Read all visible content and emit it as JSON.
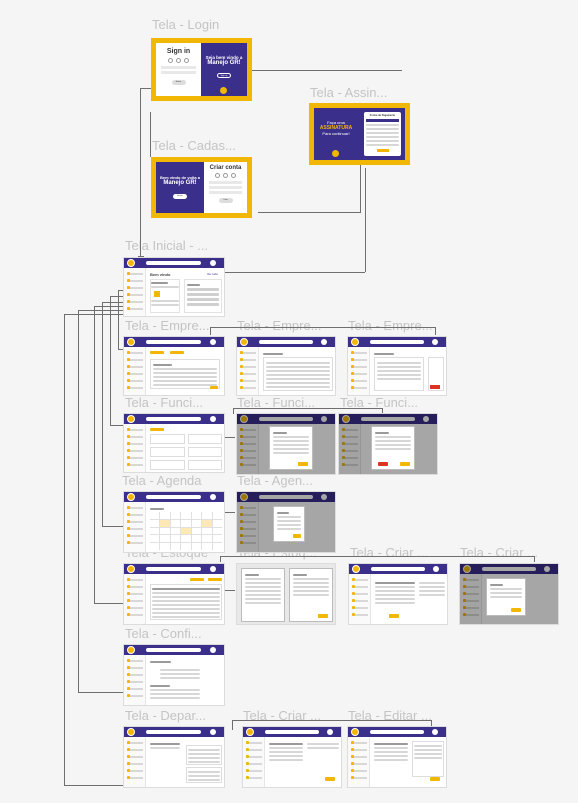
{
  "labels": {
    "login": "Tela - Login",
    "assinatura": "Tela - Assin...",
    "cadastro": "Tela - Cadas...",
    "inicial": "Tela Inicial - ...",
    "empresa1": "Tela - Empre...",
    "empresa2": "Tela - Empre...",
    "empresa3": "Tela - Empre...",
    "func1": "Tela - Funci...",
    "func2": "Tela - Funci...",
    "func3": "Tela - Funci...",
    "agenda1": "Tela - Agenda",
    "agenda2": "Tela - Agen...",
    "estoque1": "Tela - Estoque",
    "estoque2": "Tela - Estoq...",
    "criar1": "Tela - Criar ...",
    "criar2": "Tela - Criar ...",
    "config": "Tela - Confi...",
    "depar": "Tela - Depar...",
    "criar3": "Tela - Criar ...",
    "editar": "Tela - Editar ..."
  },
  "login": {
    "title": "Sign in",
    "welcome": "Seja bem vindo a",
    "brand": "Manejo GR!",
    "btn": "Entrar",
    "cta": "Sign up"
  },
  "cadastro": {
    "title": "Criar conta",
    "welcome": "Bem vindo de volta a",
    "brand": "Manejo GR!",
    "btn": "Entrar",
    "cta": "Criar"
  },
  "assinatura": {
    "line1": "Faça uma",
    "line2": "ASSINATURA",
    "line3": "Para continuar!",
    "card_title": "Forma de Pagamento"
  },
  "inicial": {
    "heading": "Bem vindo",
    "link": "Ver tudo"
  },
  "colors": {
    "primary": "#3b2f8c",
    "accent": "#f2b705",
    "connector": "#6f6f6f",
    "label": "#c4c4c4"
  }
}
